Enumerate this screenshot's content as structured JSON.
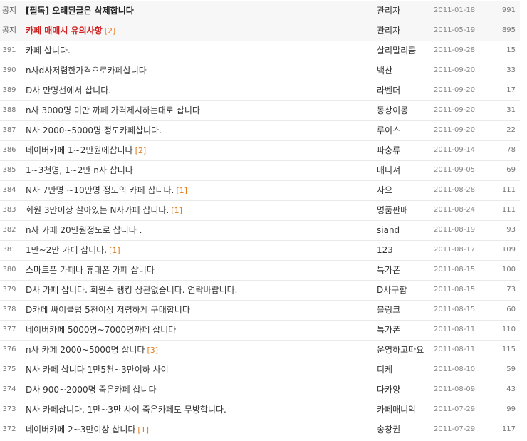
{
  "rows": [
    {
      "num": "공지",
      "title": "[필독] 오래된글은 삭제합니다",
      "comments": "",
      "author": "관리자",
      "date": "2011-01-18",
      "views": "991",
      "notice": true,
      "red": false
    },
    {
      "num": "공지",
      "title": "카페 매매시 유의사항",
      "comments": "[2]",
      "author": "관리자",
      "date": "2011-05-19",
      "views": "895",
      "notice": true,
      "red": true
    },
    {
      "num": "391",
      "title": "카페 삽니다.",
      "comments": "",
      "author": "살리말리쿰",
      "date": "2011-09-28",
      "views": "15"
    },
    {
      "num": "390",
      "title": "n사d사저렴한가격으로카페삽니다",
      "comments": "",
      "author": "백산",
      "date": "2011-09-20",
      "views": "33"
    },
    {
      "num": "389",
      "title": "D사 만명선에서 삽니다.",
      "comments": "",
      "author": "라벤더",
      "date": "2011-09-20",
      "views": "17"
    },
    {
      "num": "388",
      "title": "n사 3000명 미만 까페 가격제시하는대로 삽니다",
      "comments": "",
      "author": "동상이몽",
      "date": "2011-09-20",
      "views": "31"
    },
    {
      "num": "387",
      "title": "N사 2000~5000명 정도카페삽니다.",
      "comments": "",
      "author": "루이스",
      "date": "2011-09-20",
      "views": "22"
    },
    {
      "num": "386",
      "title": "네이버카페 1~2만원에삽니다",
      "comments": "[2]",
      "author": "파충류",
      "date": "2011-09-14",
      "views": "78"
    },
    {
      "num": "385",
      "title": "1~3천명, 1~2만 n사 삽니다",
      "comments": "",
      "author": "매니져",
      "date": "2011-09-05",
      "views": "69"
    },
    {
      "num": "384",
      "title": "N사 7만명 ~10만명 정도의 카페 삽니다.",
      "comments": "[1]",
      "author": "사요",
      "date": "2011-08-28",
      "views": "111"
    },
    {
      "num": "383",
      "title": "회원 3만이상 살아있는 N사카페 삽니다.",
      "comments": "[1]",
      "author": "명품판매",
      "date": "2011-08-24",
      "views": "111"
    },
    {
      "num": "382",
      "title": "n사 카페 20만원정도로 삽니다 .",
      "comments": "",
      "author": "siand",
      "date": "2011-08-19",
      "views": "93"
    },
    {
      "num": "381",
      "title": "1만~2만 카페 삽니다.",
      "comments": "[1]",
      "author": "123",
      "date": "2011-08-17",
      "views": "109"
    },
    {
      "num": "380",
      "title": "스마트폰 카페나 휴대폰 카페 삽니다",
      "comments": "",
      "author": "특가폰",
      "date": "2011-08-15",
      "views": "100"
    },
    {
      "num": "379",
      "title": "D사 카페 삽니다. 회원수 랭킹 상관없습니다. 연락바랍니다.",
      "comments": "",
      "author": "D사구합",
      "date": "2011-08-15",
      "views": "73"
    },
    {
      "num": "378",
      "title": "D카페 싸이클럽 5천이상 저렴하게 구매합니다",
      "comments": "",
      "author": "블링크",
      "date": "2011-08-15",
      "views": "60"
    },
    {
      "num": "377",
      "title": "네이버카페 5000명~7000명까페 삽니다",
      "comments": "",
      "author": "특가폰",
      "date": "2011-08-11",
      "views": "110"
    },
    {
      "num": "376",
      "title": "n사 카페 2000~5000명 삽니다",
      "comments": "[3]",
      "author": "운영하고파요",
      "date": "2011-08-11",
      "views": "115"
    },
    {
      "num": "375",
      "title": "N사 카페 삽니다 1만5천~3만이하 사이",
      "comments": "",
      "author": "디케",
      "date": "2011-08-10",
      "views": "59"
    },
    {
      "num": "374",
      "title": "D사 900~2000명 죽은카페 삽니다",
      "comments": "",
      "author": "다카양",
      "date": "2011-08-09",
      "views": "43"
    },
    {
      "num": "373",
      "title": "N사 카페삽니다. 1만~3만 사이 죽은카페도 무방합니다.",
      "comments": "",
      "author": "카페매니악",
      "date": "2011-07-29",
      "views": "99"
    },
    {
      "num": "372",
      "title": "네이버카페 2~3만이상 삽니다",
      "comments": "[1]",
      "author": "송창권",
      "date": "2011-07-29",
      "views": "117"
    }
  ]
}
